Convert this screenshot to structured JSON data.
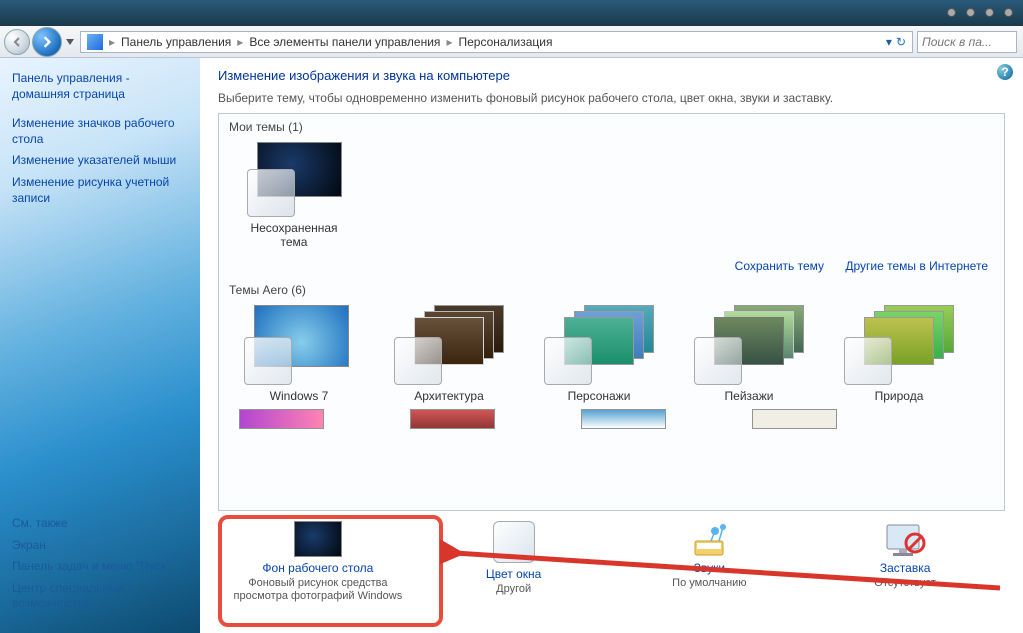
{
  "breadcrumb": {
    "items": [
      "Панель управления",
      "Все элементы панели управления",
      "Персонализация"
    ]
  },
  "search": {
    "placeholder": "Поиск в па..."
  },
  "sidebar": {
    "top": [
      "Панель управления - домашняя страница",
      "Изменение значков рабочего стола",
      "Изменение указателей мыши",
      "Изменение рисунка учетной записи"
    ],
    "see_also_label": "См. также",
    "bottom": [
      "Экран",
      "Панель задач и меню \"Пуск\"",
      "Центр специальных возможностей"
    ]
  },
  "main": {
    "title": "Изменение изображения и звука на компьютере",
    "subtitle": "Выберите тему, чтобы одновременно изменить фоновый рисунок рабочего стола, цвет окна, звуки и заставку.",
    "my_themes_label": "Мои темы (1)",
    "my_themes": [
      {
        "name": "Несохраненная тема"
      }
    ],
    "save_theme": "Сохранить тему",
    "online_themes": "Другие темы в Интернете",
    "aero_label": "Темы Aero (6)",
    "aero_themes": [
      {
        "name": "Windows 7"
      },
      {
        "name": "Архитектура"
      },
      {
        "name": "Персонажи"
      },
      {
        "name": "Пейзажи"
      },
      {
        "name": "Природа"
      }
    ]
  },
  "bottom": {
    "items": [
      {
        "title": "Фон рабочего стола",
        "sub": "Фоновый рисунок средства просмотра фотографий Windows"
      },
      {
        "title": "Цвет окна",
        "sub": "Другой"
      },
      {
        "title": "Звуки",
        "sub": "По умолчанию"
      },
      {
        "title": "Заставка",
        "sub": "Отсутствует"
      }
    ]
  }
}
